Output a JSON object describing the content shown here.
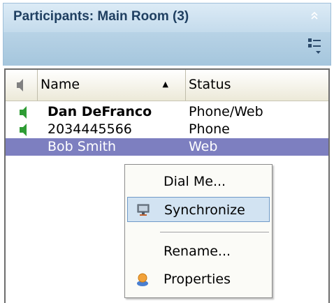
{
  "panel": {
    "title": "Participants: Main Room (3)",
    "collapse_icon": "double-chevron-up-icon",
    "options_icon": "list-options-icon"
  },
  "columns": {
    "audio_icon": "speaker-icon",
    "name": "Name",
    "name_sort": "▲",
    "status": "Status"
  },
  "participants": [
    {
      "name": "Dan DeFranco",
      "status": "Phone/Web",
      "audio_icon": "speaker-icon",
      "audio_color": "#2e9c34",
      "bold": true,
      "selected": false
    },
    {
      "name": "2034445566",
      "status": "Phone",
      "audio_icon": "speaker-icon",
      "audio_color": "#2e9c34",
      "bold": false,
      "selected": false
    },
    {
      "name": "Bob Smith",
      "status": "Web",
      "bold": false,
      "selected": true
    }
  ],
  "context_menu": {
    "items": [
      {
        "label": "Dial Me...",
        "icon": ""
      },
      {
        "label": "Synchronize",
        "icon": "monitor-icon",
        "highlighted": true
      },
      {
        "label": "Rename...",
        "icon": ""
      },
      {
        "label": "Properties",
        "icon": "person-icon"
      }
    ]
  },
  "colors": {
    "title_text": "#1f3f61",
    "selection": "#7d7fc0",
    "menu_highlight": "#d2e3f2",
    "speaker_active": "#2e9c34"
  }
}
